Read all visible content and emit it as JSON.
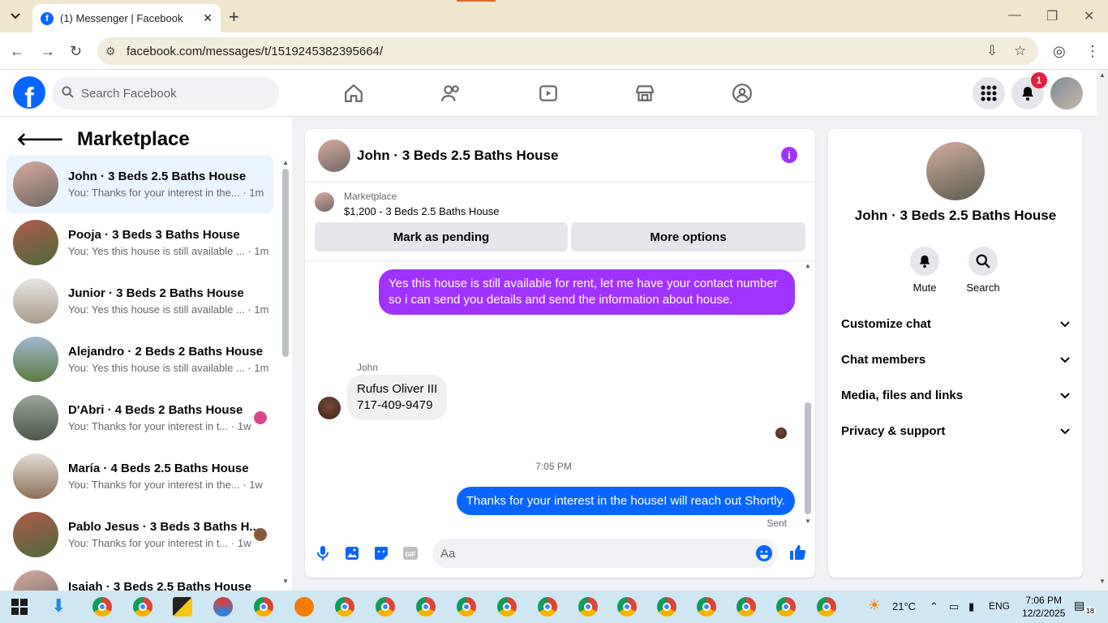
{
  "browser": {
    "tab_title": "(1) Messenger | Facebook",
    "url": "facebook.com/messages/t/1519245382395664/"
  },
  "fb": {
    "search_placeholder": "Search Facebook",
    "notification_count": "1"
  },
  "left": {
    "title": "Marketplace",
    "conversations": [
      {
        "name": "John · 3 Beds 2.5 Baths House",
        "snippet": "You: Thanks for your interest in the...",
        "time": "· 1m",
        "color": "#8a7a6a"
      },
      {
        "name": "Pooja · 3 Beds 3 Baths House",
        "snippet": "You: Yes this house is still available ...",
        "time": "· 1m",
        "color": "#a0665a"
      },
      {
        "name": "Junior · 3 Beds 2 Baths House",
        "snippet": "You: Yes this house is still available ...",
        "time": "· 1m",
        "color": "#c9c4bf"
      },
      {
        "name": "Alejandro · 2 Beds 2 Baths House",
        "snippet": "You: Yes this house is still available ...",
        "time": "· 1m",
        "color": "#6e8a5a"
      },
      {
        "name": "D'Abri · 4 Beds 2 Baths House",
        "snippet": "You: Thanks for your interest in t...",
        "time": "· 1w",
        "color": "#7d8574"
      },
      {
        "name": "María · 4 Beds 2.5 Baths House",
        "snippet": "You: Thanks for your interest in the...",
        "time": "· 1w",
        "color": "#b8a898"
      },
      {
        "name": "Pablo Jesus · 3 Beds 3 Baths H...",
        "snippet": "You: Thanks for your interest in t...",
        "time": "· 1w",
        "color": "#9a5c4a"
      },
      {
        "name": "Isaiah · 3 Beds 2.5 Baths House",
        "snippet": "",
        "time": "",
        "color": "#8a7a6a"
      }
    ]
  },
  "chat": {
    "title": "John · 3 Beds 2.5 Baths House",
    "marketplace_label": "Marketplace",
    "listing": "$1,200 - 3 Beds 2.5 Baths House",
    "mark_pending": "Mark as pending",
    "more_options": "More options",
    "msg_out_1": "Yes this house is still available for rent, let me have your contact number so i can send you details and send the information about house.",
    "sender_name": "John",
    "msg_in_line1": "Rufus Oliver III",
    "msg_in_line2": "717-409-9479",
    "timestamp": "7:05 PM",
    "msg_out_2": "Thanks for your interest in the houseI will reach out Shortly.",
    "status": "Sent",
    "composer_placeholder": "Aa"
  },
  "info": {
    "name": "John · 3 Beds 2.5 Baths House",
    "mute": "Mute",
    "search": "Search",
    "sections": [
      "Customize chat",
      "Chat members",
      "Media, files and links",
      "Privacy & support"
    ]
  },
  "taskbar": {
    "temperature": "21°C",
    "language": "ENG",
    "time": "7:06 PM",
    "date": "12/2/2025",
    "notif": "18"
  },
  "colors": {
    "brand": "#0866ff",
    "accent": "#a033ff"
  }
}
